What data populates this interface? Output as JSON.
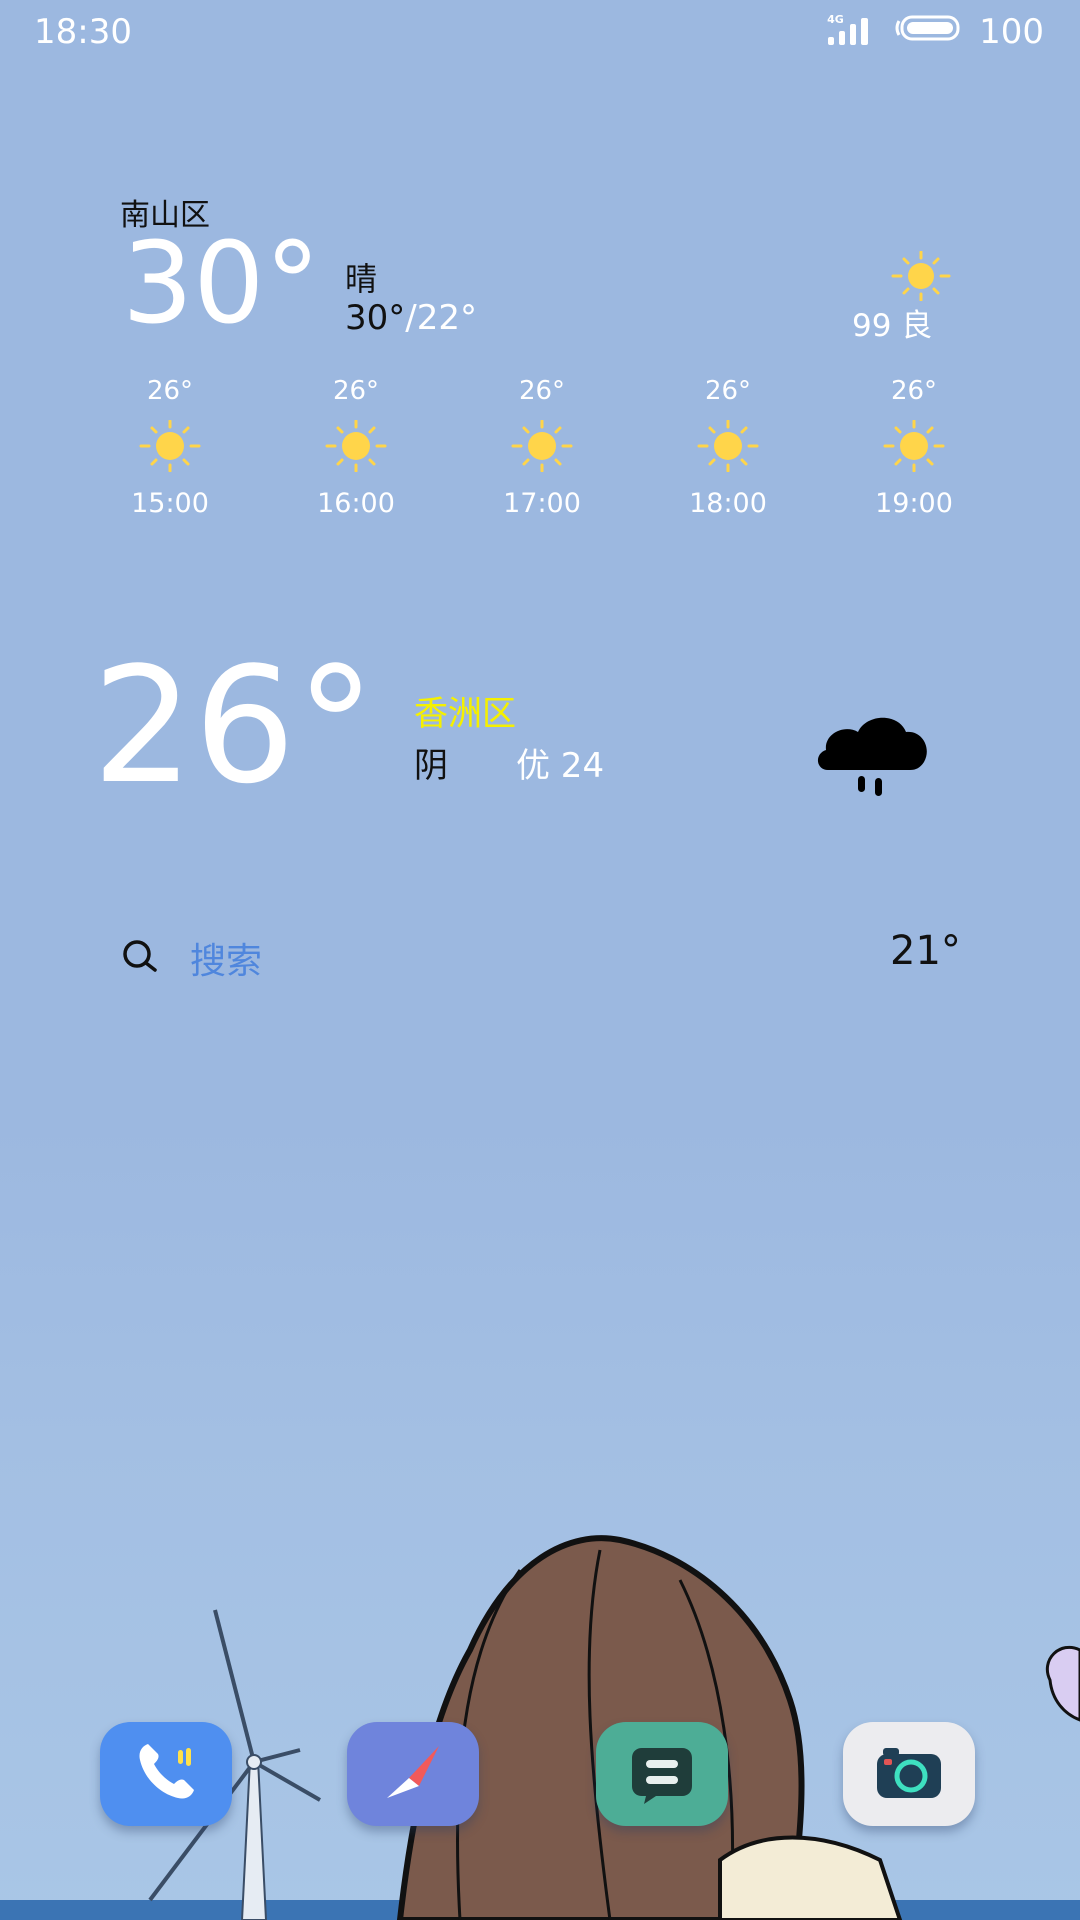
{
  "status_bar": {
    "time": "18:30",
    "network": "4G",
    "battery": "100",
    "icons": [
      "signal-icon",
      "battery-icon"
    ]
  },
  "weather_widget": {
    "location": "南山区",
    "temperature": "30°",
    "condition": "晴",
    "high": "30°",
    "low": "22°",
    "aqi_value": "99",
    "aqi_label": "良",
    "aqi_text": "99 良",
    "hourly": [
      {
        "temp": "26°",
        "time": "15:00",
        "icon": "sun-icon"
      },
      {
        "temp": "26°",
        "time": "16:00",
        "icon": "sun-icon"
      },
      {
        "temp": "26°",
        "time": "17:00",
        "icon": "sun-icon"
      },
      {
        "temp": "26°",
        "time": "18:00",
        "icon": "sun-icon"
      },
      {
        "temp": "26°",
        "time": "19:00",
        "icon": "sun-icon"
      }
    ]
  },
  "weather_widget_2": {
    "temperature": "26°",
    "location": "香洲区",
    "condition": "阴",
    "aqi_text": "优 24",
    "icon": "cloud-rain-icon"
  },
  "search_bar": {
    "placeholder": "搜索",
    "temperature": "21°",
    "icon": "search-icon"
  },
  "dock": [
    {
      "name": "phone",
      "icon": "phone-icon",
      "color": "#4f8ff0"
    },
    {
      "name": "browser",
      "icon": "compass-icon",
      "color": "#6f84dc"
    },
    {
      "name": "messages",
      "icon": "message-icon",
      "color": "#4dad96"
    },
    {
      "name": "camera",
      "icon": "camera-icon",
      "color": "#ececef"
    }
  ],
  "colors": {
    "background": "#9cb8e0",
    "accent_yellow": "#f5f000",
    "search_blue": "#4f86dd",
    "sun": "#ffd54a"
  }
}
